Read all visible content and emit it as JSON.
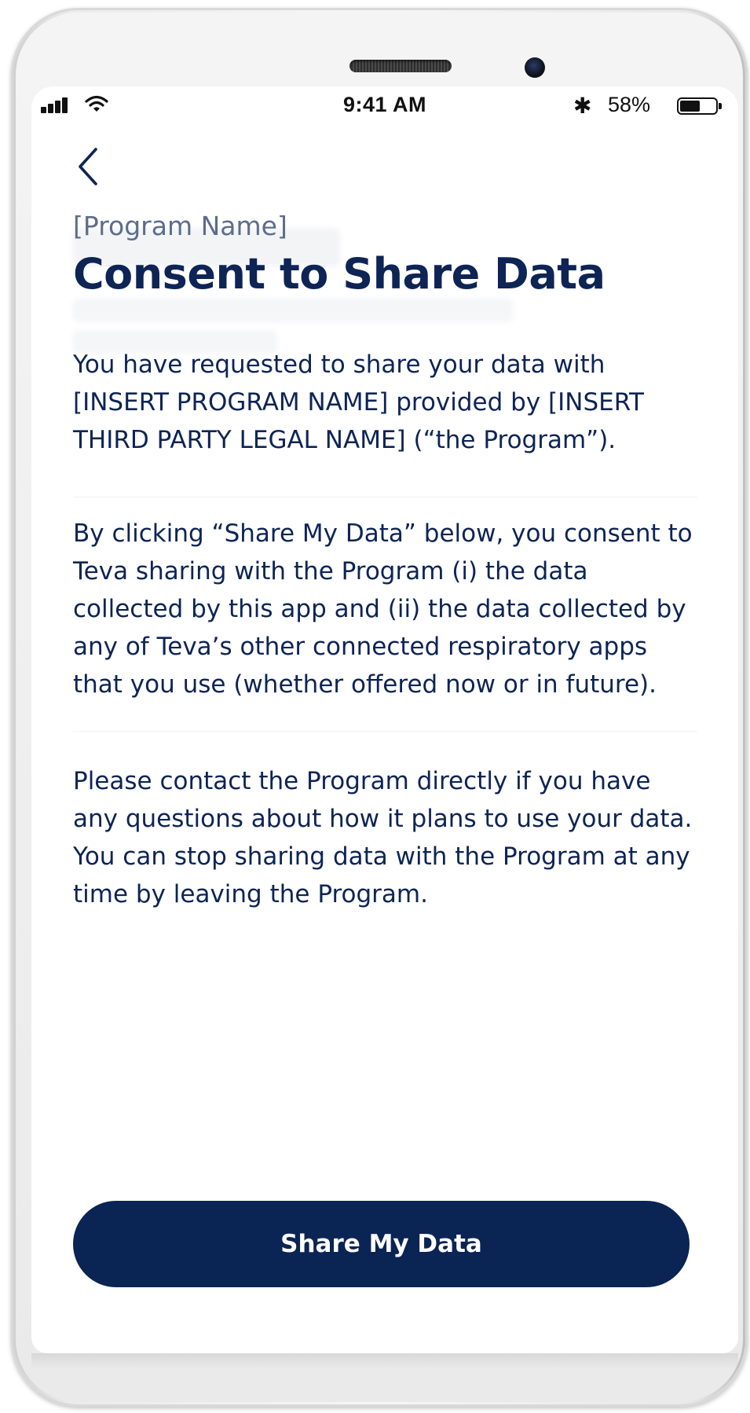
{
  "status_bar": {
    "time": "9:41 AM",
    "battery_percent": "58%",
    "battery_level": 0.58,
    "bluetooth_glyph": "✱"
  },
  "nav": {
    "back_icon": "chevron-left-icon"
  },
  "header": {
    "program_name": "[Program Name]",
    "title": "Consent to Share Data"
  },
  "content": {
    "paragraph_1": "You have requested to share your data with [INSERT PROGRAM NAME] provided by [INSERT THIRD PARTY LEGAL NAME] (“the Program”).",
    "paragraph_2": "By clicking “Share My Data” below, you consent to Teva sharing with the Program (i) the data collected by this app and (ii) the data collected by any of Teva’s other connected respiratory apps that you use (whether offered now or in future).",
    "paragraph_3": "Please contact the Program directly if you have any questions about how it plans to use your data.  You can stop sharing data with the Program at any time by leaving the Program."
  },
  "actions": {
    "share_label": "Share My Data"
  },
  "colors": {
    "primary": "#0a2454",
    "subtitle": "#5c6d8c",
    "text": "#0d2455"
  }
}
